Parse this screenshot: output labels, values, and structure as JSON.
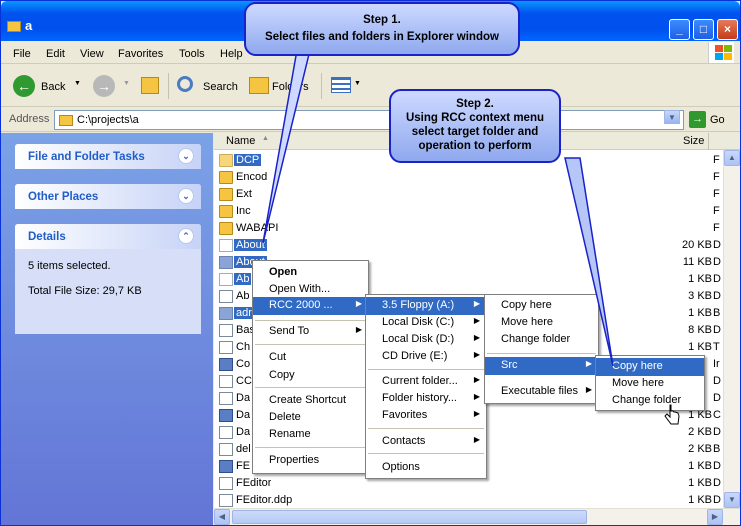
{
  "window": {
    "title": "a"
  },
  "menubar": [
    "File",
    "Edit",
    "View",
    "Favorites",
    "Tools",
    "Help"
  ],
  "toolbar": {
    "back_label": "Back",
    "search_label": "Search",
    "folders_label": "Folders"
  },
  "address": {
    "label": "Address",
    "value": "C:\\projects\\a",
    "go_label": "Go"
  },
  "taskpane": {
    "file_folder_tasks": "File and Folder Tasks",
    "other_places": "Other Places",
    "details": "Details",
    "details_selected": "5 items selected.",
    "details_size": "Total File Size: 29,7 KB"
  },
  "columns": {
    "name": "Name",
    "size": "Size"
  },
  "files": [
    {
      "name": "DCP",
      "size": "",
      "type": "F",
      "icon": "folder",
      "selected": true
    },
    {
      "name": "Encod",
      "size": "",
      "type": "F",
      "icon": "folder",
      "selected": false
    },
    {
      "name": "Ext",
      "size": "",
      "type": "F",
      "icon": "folder",
      "selected": false
    },
    {
      "name": "Inc",
      "size": "",
      "type": "F",
      "icon": "folder",
      "selected": false
    },
    {
      "name": "WABAPI",
      "size": "",
      "type": "F",
      "icon": "folder",
      "selected": false
    },
    {
      "name": "About",
      "size": "20 KB",
      "type": "D",
      "icon": "file",
      "selected": true
    },
    {
      "name": "About",
      "size": "11 KB",
      "type": "D",
      "icon": "file",
      "selected": true
    },
    {
      "name": "Ab",
      "size": "1 KB",
      "type": "D",
      "icon": "file",
      "selected": true
    },
    {
      "name": "Ab",
      "size": "3 KB",
      "type": "D",
      "icon": "file",
      "selected": false
    },
    {
      "name": "adr",
      "size": "1 KB",
      "type": "B",
      "icon": "file",
      "selected": true
    },
    {
      "name": "Bas",
      "size": "8 KB",
      "type": "D",
      "icon": "file",
      "selected": false
    },
    {
      "name": "Ch",
      "size": "1 KB",
      "type": "T",
      "icon": "file",
      "selected": false
    },
    {
      "name": "Co",
      "size": "",
      "type": "Ir",
      "icon": "file",
      "selected": false
    },
    {
      "name": "CC",
      "size": "",
      "type": "D",
      "icon": "file",
      "selected": false
    },
    {
      "name": "Da",
      "size": "",
      "type": "D",
      "icon": "file",
      "selected": false
    },
    {
      "name": "Da",
      "size": "1 KB",
      "type": "C",
      "icon": "file",
      "selected": false
    },
    {
      "name": "Da",
      "size": "2 KB",
      "type": "D",
      "icon": "file",
      "selected": false
    },
    {
      "name": "del",
      "size": "2 KB",
      "type": "B",
      "icon": "file",
      "selected": false
    },
    {
      "name": "FE",
      "size": "1 KB",
      "type": "D",
      "icon": "file",
      "selected": false
    },
    {
      "name": "FEditor",
      "size": "1 KB",
      "type": "D",
      "icon": "file",
      "selected": false
    },
    {
      "name": "FEditor.ddp",
      "size": "1 KB",
      "type": "D",
      "icon": "file",
      "selected": false
    }
  ],
  "context_menu": {
    "open": "Open",
    "open_with": "Open With...",
    "rcc": "RCC 2000 ...",
    "send_to": "Send To",
    "cut": "Cut",
    "copy": "Copy",
    "create_shortcut": "Create Shortcut",
    "delete": "Delete",
    "rename": "Rename",
    "properties": "Properties"
  },
  "rcc_menu": {
    "floppy": "3.5 Floppy (A:)",
    "local_c": "Local Disk (C:)",
    "local_d": "Local Disk (D:)",
    "cd": "CD Drive (E:)",
    "current_folder": "Current folder...",
    "folder_history": "Folder history...",
    "favorites": "Favorites",
    "contacts": "Contacts",
    "options": "Options"
  },
  "floppy_menu": {
    "copy_here": "Copy here",
    "move_here": "Move here",
    "change_folder": "Change folder",
    "src": "Src",
    "executable": "Executable files"
  },
  "src_menu": {
    "copy_here": "Copy here",
    "move_here": "Move here",
    "change_folder": "Change folder"
  },
  "callouts": {
    "step1_title": "Step 1.",
    "step1_text": "Select files and folders in Explorer window",
    "step2_title": "Step 2.",
    "step2_line1": "Using RCC context menu",
    "step2_line2": "select target folder and",
    "step2_line3": "operation to perform"
  },
  "colors": {
    "title_blue": "#0053ee",
    "highlight": "#316ac5",
    "callout_border": "#1a22c8"
  }
}
